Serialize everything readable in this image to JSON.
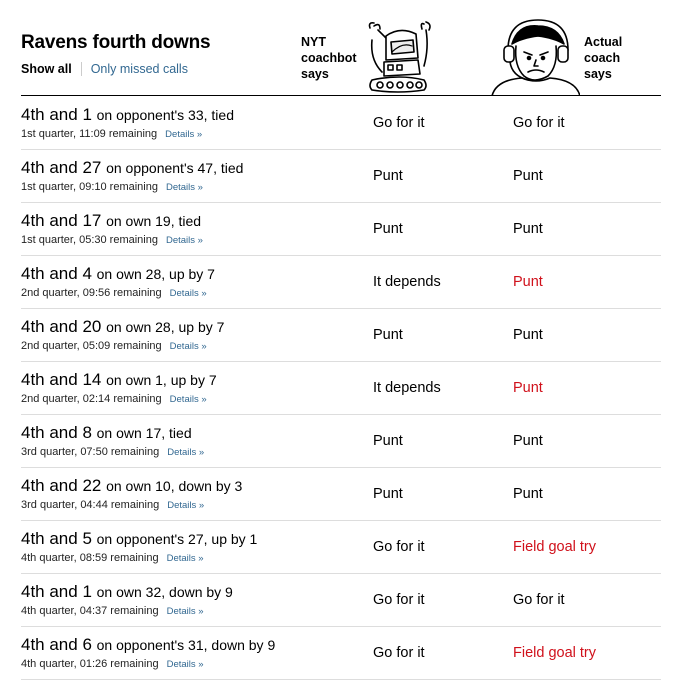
{
  "header": {
    "title": "Ravens fourth downs",
    "filter_all": "Show all",
    "filter_missed": "Only missed calls",
    "bot_label": [
      "NYT",
      "coachbot",
      "says"
    ],
    "coach_label": [
      "Actual",
      "coach",
      "says"
    ]
  },
  "icons": {
    "robot": "robot-coachbot-icon",
    "coach": "coach-headset-icon"
  },
  "colors": {
    "missed": "#d0111b",
    "link": "#326891"
  },
  "details_label": "Details »",
  "rows": [
    {
      "down": "4th and 1",
      "situation": "on opponent's 33, tied",
      "time": "1st quarter, 11:09 remaining",
      "bot": "Go for it",
      "actual": "Go for it",
      "missed": false
    },
    {
      "down": "4th and 27",
      "situation": "on opponent's 47, tied",
      "time": "1st quarter, 09:10 remaining",
      "bot": "Punt",
      "actual": "Punt",
      "missed": false
    },
    {
      "down": "4th and 17",
      "situation": "on own 19, tied",
      "time": "1st quarter, 05:30 remaining",
      "bot": "Punt",
      "actual": "Punt",
      "missed": false
    },
    {
      "down": "4th and 4",
      "situation": "on own 28, up by 7",
      "time": "2nd quarter, 09:56 remaining",
      "bot": "It depends",
      "actual": "Punt",
      "missed": true
    },
    {
      "down": "4th and 20",
      "situation": "on own 28, up by 7",
      "time": "2nd quarter, 05:09 remaining",
      "bot": "Punt",
      "actual": "Punt",
      "missed": false
    },
    {
      "down": "4th and 14",
      "situation": "on own 1, up by 7",
      "time": "2nd quarter, 02:14 remaining",
      "bot": "It depends",
      "actual": "Punt",
      "missed": true
    },
    {
      "down": "4th and 8",
      "situation": "on own 17, tied",
      "time": "3rd quarter, 07:50 remaining",
      "bot": "Punt",
      "actual": "Punt",
      "missed": false
    },
    {
      "down": "4th and 22",
      "situation": "on own 10, down by 3",
      "time": "3rd quarter, 04:44 remaining",
      "bot": "Punt",
      "actual": "Punt",
      "missed": false
    },
    {
      "down": "4th and 5",
      "situation": "on opponent's 27, up by 1",
      "time": "4th quarter, 08:59 remaining",
      "bot": "Go for it",
      "actual": "Field goal try",
      "missed": true
    },
    {
      "down": "4th and 1",
      "situation": "on own 32, down by 9",
      "time": "4th quarter, 04:37 remaining",
      "bot": "Go for it",
      "actual": "Go for it",
      "missed": false
    },
    {
      "down": "4th and 6",
      "situation": "on opponent's 31, down by 9",
      "time": "4th quarter, 01:26 remaining",
      "bot": "Go for it",
      "actual": "Field goal try",
      "missed": true
    }
  ]
}
